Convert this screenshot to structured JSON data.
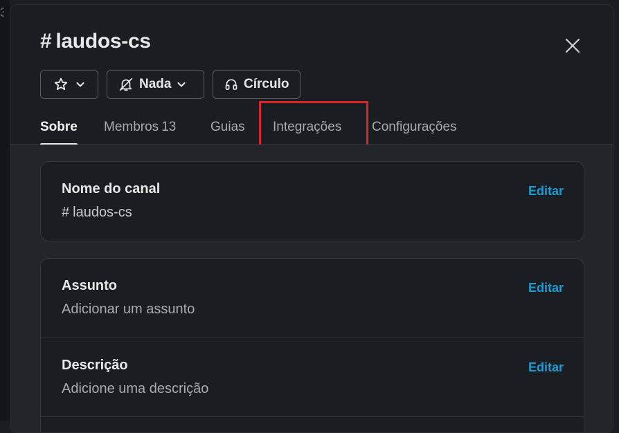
{
  "channel": {
    "hash": "#",
    "name": "laudos-cs"
  },
  "header_buttons": {
    "notifications_label": "Nada",
    "huddle_label": "Círculo"
  },
  "tabs": [
    {
      "label": "Sobre",
      "active": true
    },
    {
      "label": "Membros",
      "count": "13"
    },
    {
      "label": "Guias"
    },
    {
      "label": "Integrações",
      "highlighted": true
    },
    {
      "label": "Configurações"
    }
  ],
  "about": {
    "channel_name": {
      "label": "Nome do canal",
      "value_hash": "#",
      "value": "laudos-cs",
      "edit_label": "Editar"
    },
    "topic": {
      "label": "Assunto",
      "placeholder": "Adicionar um assunto",
      "edit_label": "Editar"
    },
    "description": {
      "label": "Descrição",
      "placeholder": "Adicione uma descrição",
      "edit_label": "Editar"
    }
  },
  "icons": {
    "star": "star-icon",
    "bell_off": "bell-off-icon",
    "headphones": "headphones-icon",
    "close": "close-icon",
    "chevron": "chevron-down-icon"
  },
  "colors": {
    "accent_link": "#1d9bd1",
    "highlight_box": "#d62828",
    "modal_bg": "#1a1d21",
    "content_bg": "#222529"
  }
}
